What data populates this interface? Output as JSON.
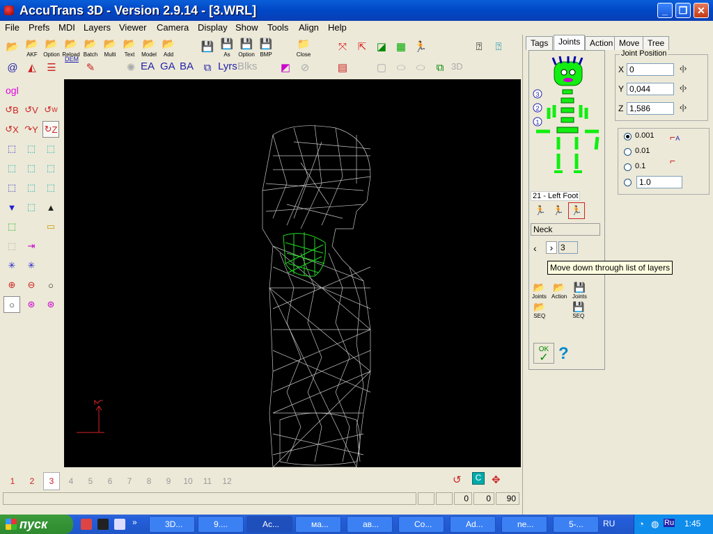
{
  "window": {
    "title": "AccuTrans 3D - Version 2.9.14 - [3.WRL]",
    "minimize": "_",
    "maximize": "❐",
    "close": "✕"
  },
  "menu": [
    "File",
    "Prefs",
    "MDI",
    "Layers",
    "Viewer",
    "Camera",
    "Display",
    "Show",
    "Tools",
    "Align",
    "Help"
  ],
  "toolbar": {
    "labels": {
      "akf": "AKF",
      "option": "Option",
      "reload": "Reload",
      "batch": "Batch",
      "multi": "Multi",
      "text": "Text",
      "model": "Model",
      "add": "Add",
      "as": "As",
      "option2": "Option",
      "bmp": "BMP",
      "close": "Close"
    },
    "row2_text": {
      "dem": "DEM",
      "ea": "EA",
      "ga": "GA",
      "ba": "BA",
      "lyrs": "Lyrs",
      "blks": "Blks",
      "three_d": "3D"
    }
  },
  "left": {
    "ogl": "ogl",
    "b": "B",
    "v": "V",
    "w": "W",
    "x": "X",
    "y": "Y",
    "z": "Z"
  },
  "panel": {
    "tabs": [
      "Tags",
      "Joints",
      "Action",
      "Move",
      "Tree"
    ],
    "joint_position_title": "Joint Position",
    "x_label": "X",
    "x_value": "0",
    "y_label": "Y",
    "y_value": "0,044",
    "z_label": "Z",
    "z_value": "1,586",
    "arrows": "‹|›",
    "steps": [
      "0.001",
      "0.01",
      "0.1"
    ],
    "custom_step": "1.0",
    "selected_step": "0.001",
    "joint_name": "21 - Left Foot",
    "neck_field": "Neck",
    "layer_num": "3",
    "levels": [
      "3",
      "2",
      "1"
    ],
    "btn_joints": "Joints",
    "btn_action": "Action",
    "btn_joints2": "Joints",
    "btn_seq": "SEQ",
    "btn_seq2": "SEQ",
    "ok": "OK",
    "help": "?",
    "a_label": "A"
  },
  "tooltip": "Move down through list of layers",
  "layers": {
    "items": [
      "1",
      "2",
      "3",
      "4",
      "5",
      "6",
      "7",
      "8",
      "9",
      "10",
      "11",
      "12"
    ],
    "active": "3"
  },
  "status": {
    "v1": "0",
    "v2": "0",
    "v3": "90"
  },
  "taskbar": {
    "start": "пуск",
    "tasks": [
      "3D...",
      "9....",
      "Ac...",
      "ма...",
      "ав...",
      "Co...",
      "Ad...",
      "ne...",
      "5-..."
    ],
    "lang": "RU",
    "tray_lang": "Ru",
    "time": "1:45"
  },
  "colors": {
    "wire": "#c8c8c8",
    "neck": "#22dd22",
    "accent": "#0a5fd8"
  }
}
